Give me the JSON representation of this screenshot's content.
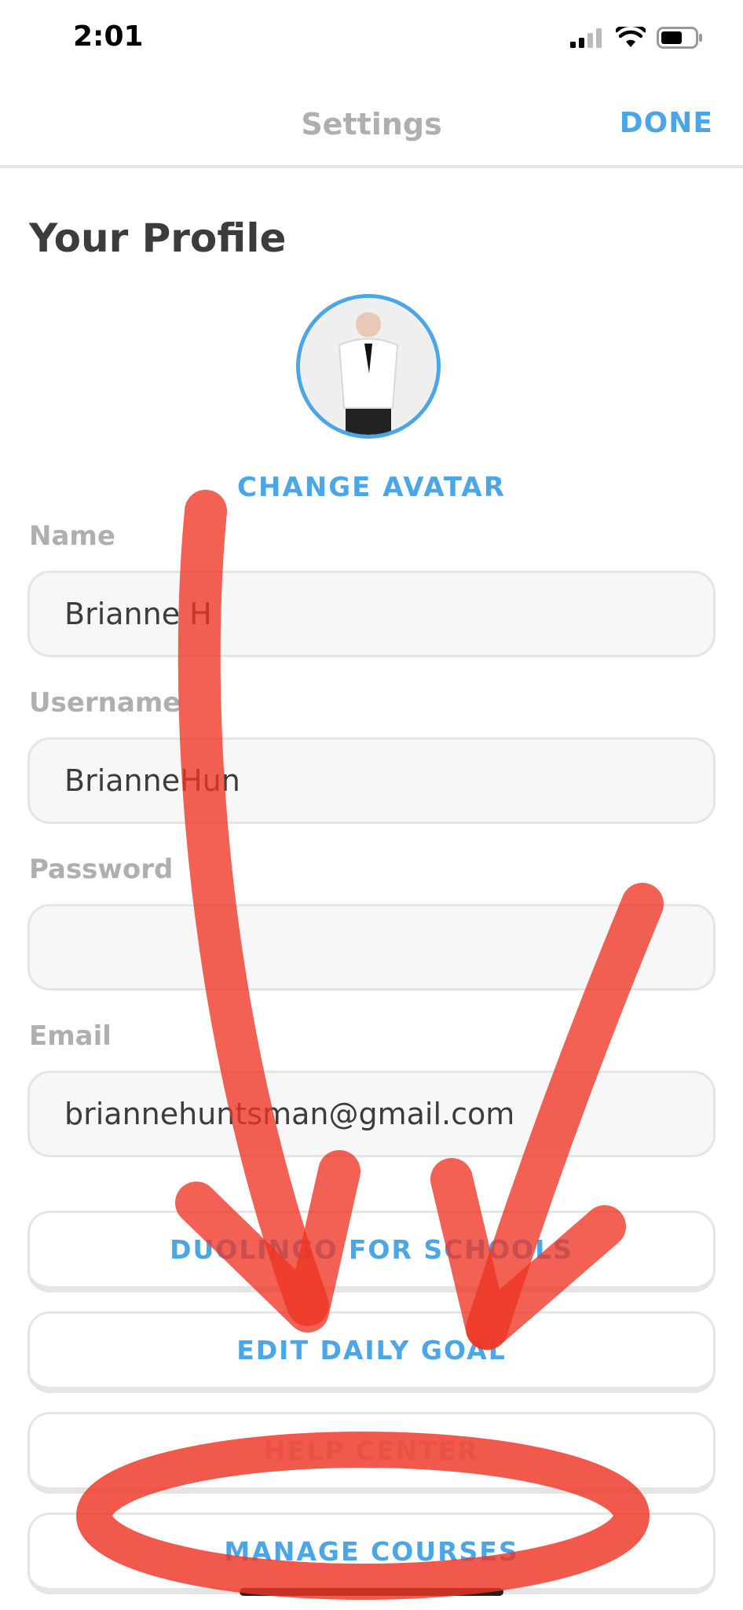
{
  "status_bar": {
    "time": "2:01"
  },
  "nav": {
    "title": "Settings",
    "done_label": "DONE"
  },
  "profile": {
    "section_title": "Your Profile",
    "change_avatar_label": "CHANGE AVATAR"
  },
  "fields": {
    "name": {
      "label": "Name",
      "value": "Brianne H"
    },
    "username": {
      "label": "Username",
      "value": "BrianneHun"
    },
    "password": {
      "label": "Password",
      "value": ""
    },
    "email": {
      "label": "Email",
      "value": "briannehuntsman@gmail.com"
    }
  },
  "actions": {
    "schools": "DUOLINGO FOR SCHOOLS",
    "daily_goal": "EDIT DAILY GOAL",
    "help_center": "HELP CENTER",
    "manage_courses": "MANAGE COURSES"
  },
  "colors": {
    "accent": "#4ba6e8",
    "annotation": "#ee3524"
  }
}
